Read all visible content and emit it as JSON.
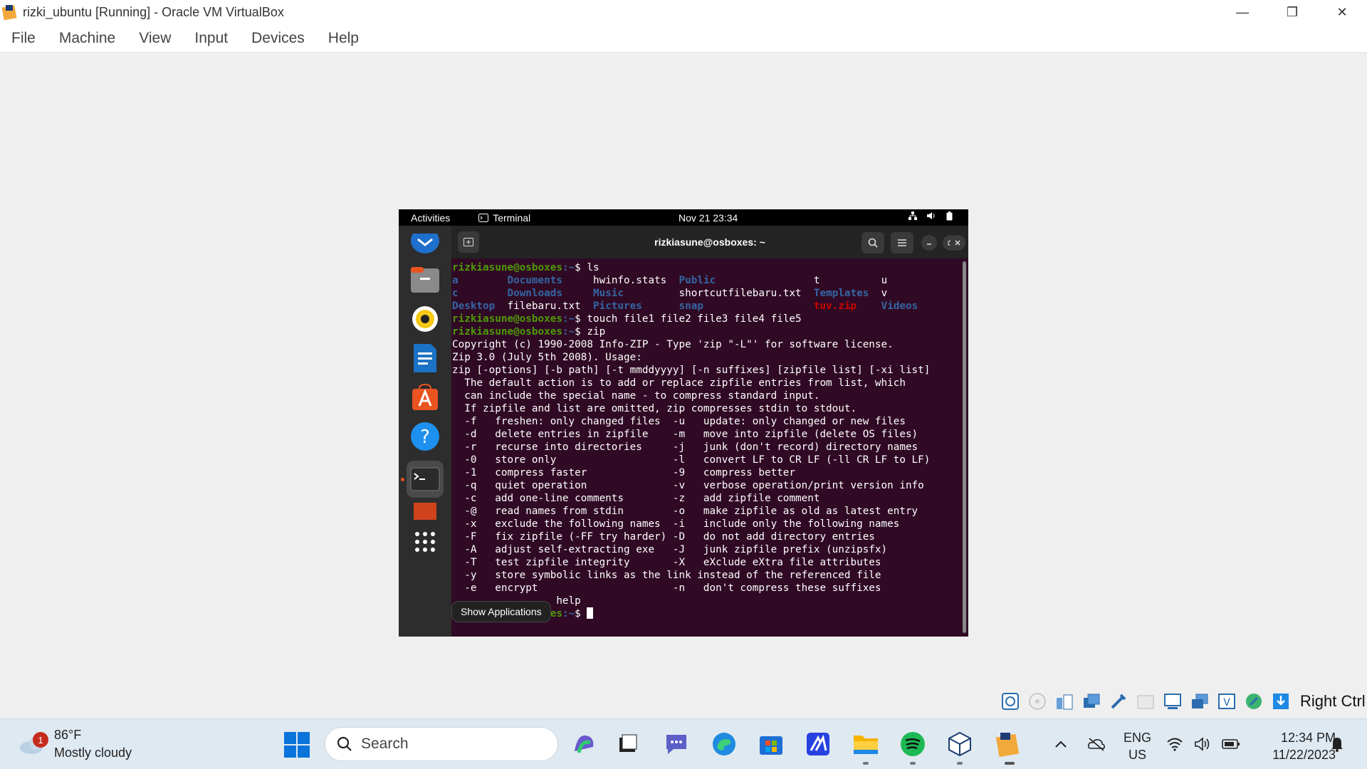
{
  "window": {
    "title": "rizki_ubuntu [Running] - Oracle VM VirtualBox",
    "minimize": "—",
    "restore": "❐",
    "close": "✕"
  },
  "menu": [
    "File",
    "Machine",
    "View",
    "Input",
    "Devices",
    "Help"
  ],
  "gnome": {
    "activities": "Activities",
    "app_name": "Terminal",
    "clock": "Nov 21  23:34"
  },
  "terminal": {
    "title": "rizkiasune@osboxes: ~",
    "prompt_user": "rizkiasune@osboxes",
    "prompt_path": ":~",
    "prompt_end": "$ ",
    "cmd_ls": "ls",
    "ls_rows": [
      [
        {
          "t": "a",
          "k": "dir"
        },
        {
          "t": "Documents",
          "k": "dir"
        },
        {
          "t": "hwinfo.stats",
          "k": "file"
        },
        {
          "t": "Public",
          "k": "dir"
        },
        {
          "t": "t",
          "k": "file"
        },
        {
          "t": "u",
          "k": "file"
        }
      ],
      [
        {
          "t": "c",
          "k": "dir"
        },
        {
          "t": "Downloads",
          "k": "dir"
        },
        {
          "t": "Music",
          "k": "dir"
        },
        {
          "t": "shortcutfilebaru.txt",
          "k": "file"
        },
        {
          "t": "Templates",
          "k": "dir"
        },
        {
          "t": "v",
          "k": "file"
        }
      ],
      [
        {
          "t": "Desktop",
          "k": "dir"
        },
        {
          "t": "filebaru.txt",
          "k": "file"
        },
        {
          "t": "Pictures",
          "k": "dir"
        },
        {
          "t": "snap",
          "k": "dir"
        },
        {
          "t": "tuv.zip",
          "k": "zip"
        },
        {
          "t": "Videos",
          "k": "dir"
        }
      ]
    ],
    "cmd_touch": "touch file1 file2 file3 file4 file5",
    "cmd_zip": "zip",
    "zip_output": [
      "Copyright (c) 1990-2008 Info-ZIP - Type 'zip \"-L\"' for software license.",
      "Zip 3.0 (July 5th 2008). Usage:",
      "zip [-options] [-b path] [-t mmddyyyy] [-n suffixes] [zipfile list] [-xi list]",
      "  The default action is to add or replace zipfile entries from list, which",
      "  can include the special name - to compress standard input.",
      "  If zipfile and list are omitted, zip compresses stdin to stdout.",
      "  -f   freshen: only changed files  -u   update: only changed or new files",
      "  -d   delete entries in zipfile    -m   move into zipfile (delete OS files)",
      "  -r   recurse into directories     -j   junk (don't record) directory names",
      "  -0   store only                   -l   convert LF to CR LF (-ll CR LF to LF)",
      "  -1   compress faster              -9   compress better",
      "  -q   quiet operation              -v   verbose operation/print version info",
      "  -c   add one-line comments        -z   add zipfile comment",
      "  -@   read names from stdin        -o   make zipfile as old as latest entry",
      "  -x   exclude the following names  -i   include only the following names",
      "  -F   fix zipfile (-FF try harder) -D   do not add directory entries",
      "  -A   adjust self-extracting exe   -J   junk zipfile prefix (unzipsfx)",
      "  -T   test zipfile integrity       -X   eXclude eXtra file attributes",
      "  -y   store symbolic links as the link instead of the referenced file",
      "  -e   encrypt                      -n   don't compress these suffixes",
      "                 help"
    ]
  },
  "dock_tooltip": "Show Applications",
  "vbox_status": {
    "host_key": "Right Ctrl"
  },
  "taskbar": {
    "weather_temp": "86°F",
    "weather_desc": "Mostly cloudy",
    "weather_badge": "1",
    "search_placeholder": "Search",
    "lang_1": "ENG",
    "lang_2": "US",
    "time": "12:34 PM",
    "date": "11/22/2023"
  }
}
